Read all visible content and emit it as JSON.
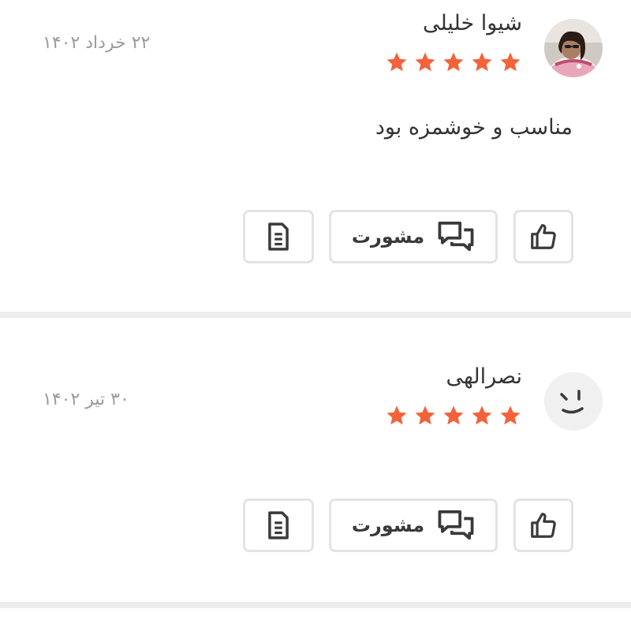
{
  "reviews": [
    {
      "name": "شیوا خلیلی",
      "date": "۲۲ خرداد ۱۴۰۲",
      "rating": 5,
      "comment": "مناسب و خوشمزه بود",
      "avatar_icon": "user-photo",
      "actions": {
        "like_icon": "thumbs-up-icon",
        "consult_label": "مشورت",
        "consult_icon": "chat-bubbles-icon",
        "report_icon": "document-icon"
      }
    },
    {
      "name": "نصرالهی",
      "date": "۳۰ تیر ۱۴۰۲",
      "rating": 5,
      "comment": "",
      "avatar_icon": "smiley-face-icon",
      "actions": {
        "like_icon": "thumbs-up-icon",
        "consult_label": "مشورت",
        "consult_icon": "chat-bubbles-icon",
        "report_icon": "document-icon"
      }
    }
  ],
  "colors": {
    "star": "#f4623a",
    "divider": "#ececec",
    "button_border": "#e3e3e3",
    "muted_text": "#9a9a9a"
  }
}
